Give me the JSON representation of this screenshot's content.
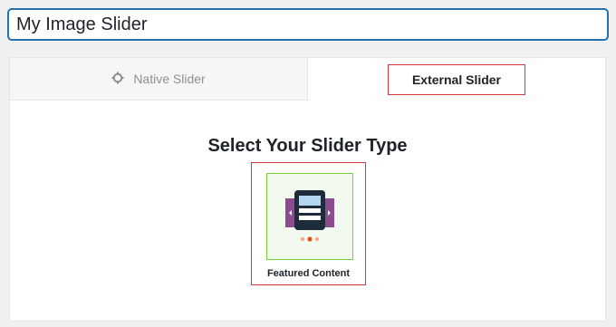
{
  "slider_title": {
    "value": "My Image Slider"
  },
  "tabs": [
    {
      "label": "Native Slider",
      "icon": "settings-icon",
      "active": false
    },
    {
      "label": "External Slider",
      "active": true
    }
  ],
  "main": {
    "heading": "Select Your Slider Type",
    "slider_types": [
      {
        "label": "Featured Content",
        "icon": "featured-content-slider-icon"
      }
    ]
  },
  "colors": {
    "accent": "#2271b1",
    "highlight_border": "#d63638",
    "icon_purple": "#8b4d8f",
    "icon_dark": "#1d2b3a",
    "icon_light_blue": "#b3d6f2",
    "dot_active": "#e84c1e",
    "dot_inactive": "#f3a88f",
    "thumb_bg": "#f2f9ee",
    "thumb_border": "#7ad03a"
  }
}
